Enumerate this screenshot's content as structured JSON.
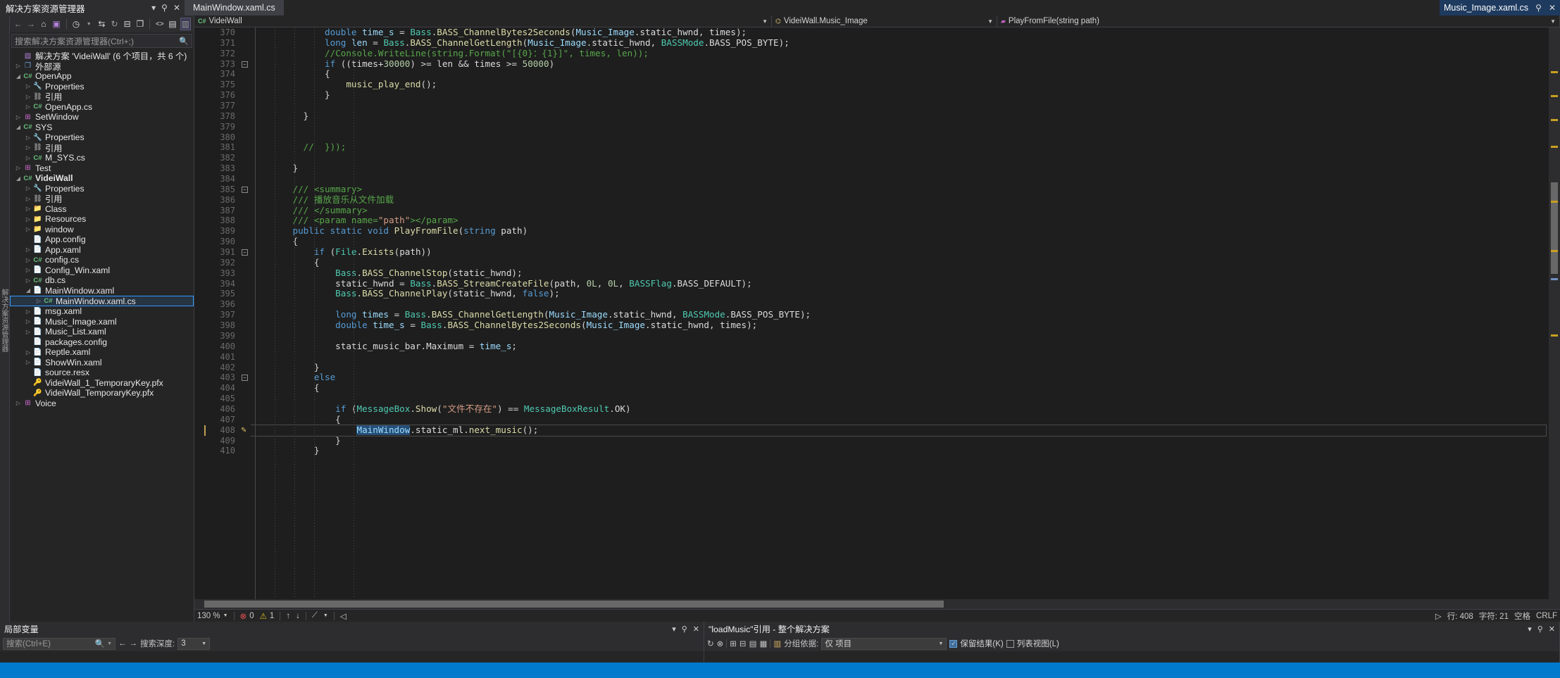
{
  "solution_explorer": {
    "caption": "解决方案资源管理器",
    "caption_buttons": [
      "▾",
      "⚲",
      "✕"
    ],
    "toolbar_icons": [
      "back-arrow",
      "forward-arrow",
      "home",
      "solution-view",
      "pending-changes",
      "sync",
      "refresh",
      "collapse-all",
      "properties",
      "show-all-files",
      "preview"
    ],
    "search_placeholder": "搜索解决方案资源管理器(Ctrl+;)",
    "tree": [
      {
        "depth": 0,
        "twist": "",
        "icon": "sln",
        "label": "解决方案 'VideiWall' (6 个项目，共 6 个)",
        "bold": false
      },
      {
        "depth": 0,
        "twist": "▷",
        "icon": "ext",
        "label": "外部源",
        "bold": false
      },
      {
        "depth": 0,
        "twist": "◢",
        "icon": "cs",
        "label": "OpenApp",
        "bold": false
      },
      {
        "depth": 1,
        "twist": "▷",
        "icon": "props",
        "label": "Properties",
        "bold": false
      },
      {
        "depth": 1,
        "twist": "▷",
        "icon": "ref",
        "label": "引用",
        "bold": false
      },
      {
        "depth": 1,
        "twist": "▷",
        "icon": "cs",
        "label": "OpenApp.cs",
        "bold": false
      },
      {
        "depth": 0,
        "twist": "▷",
        "icon": "setup",
        "label": "SetWindow",
        "bold": false
      },
      {
        "depth": 0,
        "twist": "◢",
        "icon": "cs",
        "label": "SYS",
        "bold": false
      },
      {
        "depth": 1,
        "twist": "▷",
        "icon": "props",
        "label": "Properties",
        "bold": false
      },
      {
        "depth": 1,
        "twist": "▷",
        "icon": "ref",
        "label": "引用",
        "bold": false
      },
      {
        "depth": 1,
        "twist": "▷",
        "icon": "cs",
        "label": "M_SYS.cs",
        "bold": false
      },
      {
        "depth": 0,
        "twist": "▷",
        "icon": "setup",
        "label": "Test",
        "bold": false
      },
      {
        "depth": 0,
        "twist": "◢",
        "icon": "cs",
        "label": "VideiWall",
        "bold": true
      },
      {
        "depth": 1,
        "twist": "▷",
        "icon": "props",
        "label": "Properties",
        "bold": false
      },
      {
        "depth": 1,
        "twist": "▷",
        "icon": "ref",
        "label": "引用",
        "bold": false
      },
      {
        "depth": 1,
        "twist": "▷",
        "icon": "folder",
        "label": "Class",
        "bold": false
      },
      {
        "depth": 1,
        "twist": "▷",
        "icon": "folder",
        "label": "Resources",
        "bold": false
      },
      {
        "depth": 1,
        "twist": "▷",
        "icon": "folder",
        "label": "window",
        "bold": false
      },
      {
        "depth": 1,
        "twist": "",
        "icon": "cfg",
        "label": "App.config",
        "bold": false
      },
      {
        "depth": 1,
        "twist": "▷",
        "icon": "xaml",
        "label": "App.xaml",
        "bold": false
      },
      {
        "depth": 1,
        "twist": "▷",
        "icon": "cs",
        "label": "config.cs",
        "bold": false
      },
      {
        "depth": 1,
        "twist": "▷",
        "icon": "xaml",
        "label": "Config_Win.xaml",
        "bold": false
      },
      {
        "depth": 1,
        "twist": "▷",
        "icon": "cs",
        "label": "db.cs",
        "bold": false
      },
      {
        "depth": 1,
        "twist": "◢",
        "icon": "xaml",
        "label": "MainWindow.xaml",
        "bold": false
      },
      {
        "depth": 2,
        "twist": "▷",
        "icon": "cs",
        "label": "MainWindow.xaml.cs",
        "bold": false,
        "selected": true
      },
      {
        "depth": 1,
        "twist": "▷",
        "icon": "xaml",
        "label": "msg.xaml",
        "bold": false
      },
      {
        "depth": 1,
        "twist": "▷",
        "icon": "xaml",
        "label": "Music_Image.xaml",
        "bold": false
      },
      {
        "depth": 1,
        "twist": "▷",
        "icon": "xaml",
        "label": "Music_List.xaml",
        "bold": false
      },
      {
        "depth": 1,
        "twist": "",
        "icon": "cfg",
        "label": "packages.config",
        "bold": false
      },
      {
        "depth": 1,
        "twist": "▷",
        "icon": "xaml",
        "label": "Reptle.xaml",
        "bold": false
      },
      {
        "depth": 1,
        "twist": "▷",
        "icon": "xaml",
        "label": "ShowWin.xaml",
        "bold": false
      },
      {
        "depth": 1,
        "twist": "",
        "icon": "cfg",
        "label": "source.resx",
        "bold": false
      },
      {
        "depth": 1,
        "twist": "",
        "icon": "pfx",
        "label": "VideiWall_1_TemporaryKey.pfx",
        "bold": false
      },
      {
        "depth": 1,
        "twist": "",
        "icon": "pfx",
        "label": "VideiWall_TemporaryKey.pfx",
        "bold": false
      },
      {
        "depth": 0,
        "twist": "▷",
        "icon": "setup",
        "label": "Voice",
        "bold": false
      }
    ]
  },
  "vertical_strip_label": "解决方案资源管理器",
  "editor": {
    "tab_label": "MainWindow.xaml.cs",
    "active_file_label": "Music_Image.xaml.cs",
    "file_close_btn": "✕",
    "file_pin_btn": "⚲",
    "navbar": {
      "project": "VideiWall",
      "type": "VideiWall.Music_Image",
      "member": "PlayFromFile(string path)"
    },
    "first_line_number": 370,
    "lines": [
      {
        "n": 370,
        "glyph": "",
        "html": "            <span class=\"kw\">double</span> <span class=\"id\">time_s</span> = <span class=\"cls\">Bass</span>.<span class=\"mth\">BASS_ChannelBytes2Seconds</span>(<span class=\"id\">Music_Image</span>.<span class=\"pln\">static_hwnd</span>, <span class=\"pln\">times</span>);"
      },
      {
        "n": 371,
        "glyph": "",
        "html": "            <span class=\"kw\">long</span> <span class=\"id\">len</span> = <span class=\"cls\">Bass</span>.<span class=\"mth\">BASS_ChannelGetLength</span>(<span class=\"id\">Music_Image</span>.<span class=\"pln\">static_hwnd</span>, <span class=\"cls\">BASSMode</span>.<span class=\"pln\">BASS_POS_BYTE</span>);"
      },
      {
        "n": 372,
        "glyph": "",
        "html": "            <span class=\"cmt\">//Console.WriteLine(string.Format(\"[{0}：{1}]\", times, len));</span>"
      },
      {
        "n": 373,
        "glyph": "collapse",
        "html": "            <span class=\"kw\">if</span> ((<span class=\"pln\">times</span>+<span class=\"num\">30000</span>) &gt;= <span class=\"pln\">len</span> &amp;&amp; <span class=\"pln\">times</span> &gt;= <span class=\"num\">50000</span>)"
      },
      {
        "n": 374,
        "glyph": "",
        "html": "            {"
      },
      {
        "n": 375,
        "glyph": "",
        "html": "                <span class=\"mth\">music_play_end</span>();"
      },
      {
        "n": 376,
        "glyph": "",
        "html": "            }"
      },
      {
        "n": 377,
        "glyph": "",
        "html": ""
      },
      {
        "n": 378,
        "glyph": "",
        "html": "        }"
      },
      {
        "n": 379,
        "glyph": "",
        "html": ""
      },
      {
        "n": 380,
        "glyph": "",
        "html": ""
      },
      {
        "n": 381,
        "glyph": "",
        "html": "        <span class=\"cmt\">//  }));</span>"
      },
      {
        "n": 382,
        "glyph": "",
        "html": ""
      },
      {
        "n": 383,
        "glyph": "",
        "html": "      }"
      },
      {
        "n": 384,
        "glyph": "",
        "html": ""
      },
      {
        "n": 385,
        "glyph": "collapse",
        "html": "      <span class=\"cmt\">/// &lt;summary&gt;</span>"
      },
      {
        "n": 386,
        "glyph": "",
        "html": "      <span class=\"cmt\">/// 播放音乐从文件加载</span>"
      },
      {
        "n": 387,
        "glyph": "",
        "html": "      <span class=\"cmt\">/// &lt;/summary&gt;</span>"
      },
      {
        "n": 388,
        "glyph": "",
        "html": "      <span class=\"cmt\">/// &lt;param name=</span><span class=\"str\">\"path\"</span><span class=\"cmt\">&gt;&lt;/param&gt;</span>"
      },
      {
        "n": 389,
        "glyph": "",
        "html": "      <span class=\"kw\">public static void</span> <span class=\"mth\">PlayFromFile</span>(<span class=\"kw\">string</span> <span class=\"pln\">path</span>)"
      },
      {
        "n": 390,
        "glyph": "",
        "html": "      {"
      },
      {
        "n": 391,
        "glyph": "collapse",
        "html": "          <span class=\"kw\">if</span> (<span class=\"cls\">File</span>.<span class=\"mth\">Exists</span>(<span class=\"pln\">path</span>))"
      },
      {
        "n": 392,
        "glyph": "",
        "html": "          {"
      },
      {
        "n": 393,
        "glyph": "",
        "html": "              <span class=\"cls\">Bass</span>.<span class=\"mth\">BASS_ChannelStop</span>(<span class=\"pln\">static_hwnd</span>);"
      },
      {
        "n": 394,
        "glyph": "",
        "html": "              <span class=\"pln\">static_hwnd</span> = <span class=\"cls\">Bass</span>.<span class=\"mth\">BASS_StreamCreateFile</span>(<span class=\"pln\">path</span>, <span class=\"num\">0L</span>, <span class=\"num\">0L</span>, <span class=\"cls\">BASSFlag</span>.<span class=\"pln\">BASS_DEFAULT</span>);"
      },
      {
        "n": 395,
        "glyph": "",
        "html": "              <span class=\"cls\">Bass</span>.<span class=\"mth\">BASS_ChannelPlay</span>(<span class=\"pln\">static_hwnd</span>, <span class=\"kw\">false</span>);"
      },
      {
        "n": 396,
        "glyph": "",
        "html": ""
      },
      {
        "n": 397,
        "glyph": "",
        "html": "              <span class=\"kw\">long</span> <span class=\"id\">times</span> = <span class=\"cls\">Bass</span>.<span class=\"mth\">BASS_ChannelGetLength</span>(<span class=\"id\">Music_Image</span>.<span class=\"pln\">static_hwnd</span>, <span class=\"cls\">BASSMode</span>.<span class=\"pln\">BASS_POS_BYTE</span>);"
      },
      {
        "n": 398,
        "glyph": "",
        "html": "              <span class=\"kw\">double</span> <span class=\"id\">time_s</span> = <span class=\"cls\">Bass</span>.<span class=\"mth\">BASS_ChannelBytes2Seconds</span>(<span class=\"id\">Music_Image</span>.<span class=\"pln\">static_hwnd</span>, <span class=\"pln\">times</span>);"
      },
      {
        "n": 399,
        "glyph": "",
        "html": ""
      },
      {
        "n": 400,
        "glyph": "",
        "html": "              <span class=\"pln\">static_music_bar</span>.<span class=\"pln\">Maximum</span> = <span class=\"id\">time_s</span>;"
      },
      {
        "n": 401,
        "glyph": "",
        "html": ""
      },
      {
        "n": 402,
        "glyph": "",
        "html": "          }"
      },
      {
        "n": 403,
        "glyph": "collapse",
        "html": "          <span class=\"kw\">else</span>"
      },
      {
        "n": 404,
        "glyph": "",
        "html": "          {"
      },
      {
        "n": 405,
        "glyph": "",
        "html": ""
      },
      {
        "n": 406,
        "glyph": "",
        "html": "              <span class=\"kw\">if</span> (<span class=\"cls\">MessageBox</span>.<span class=\"mth\">Show</span>(<span class=\"str\">\"文件不存在\"</span>) == <span class=\"cls\">MessageBoxResult</span>.<span class=\"pln\">OK</span>)"
      },
      {
        "n": 407,
        "glyph": "",
        "html": "              {"
      },
      {
        "n": 408,
        "glyph": "pencil",
        "html": "                  <span class=\"sel-tok\">MainWindow</span>.<span class=\"pln\">static_ml</span>.<span class=\"mth\">next_music</span>();",
        "cursor": true
      },
      {
        "n": 409,
        "glyph": "",
        "html": "              }"
      },
      {
        "n": 410,
        "glyph": "",
        "html": "          }"
      }
    ],
    "status": {
      "zoom": "130 %",
      "errors": "0",
      "warnings": "1",
      "line_label": "行: 408",
      "col_label": "字符: 21",
      "insert_mode": "空格",
      "line_ending": "CRLF"
    }
  },
  "bottom_panels": {
    "locals": {
      "caption": "局部变量",
      "caption_buttons": [
        "▾",
        "⚲",
        "✕"
      ],
      "search_placeholder": "搜索(Ctrl+E)",
      "depth_label": "搜索深度:",
      "depth_value": "3",
      "nav_back": "←",
      "nav_fwd": "→"
    },
    "find_results": {
      "caption": "\"loadMusic\"引用 - 整个解决方案",
      "caption_buttons": [
        "▾",
        "⚲",
        "✕"
      ],
      "group_by_label": "分组依据:",
      "group_by_value": "仅 项目",
      "scope_value": "整个解决方案",
      "keep_results_label": "保留结果(K)",
      "list_view_label": "列表视图(L)"
    }
  },
  "statusbar": {
    "items": []
  }
}
